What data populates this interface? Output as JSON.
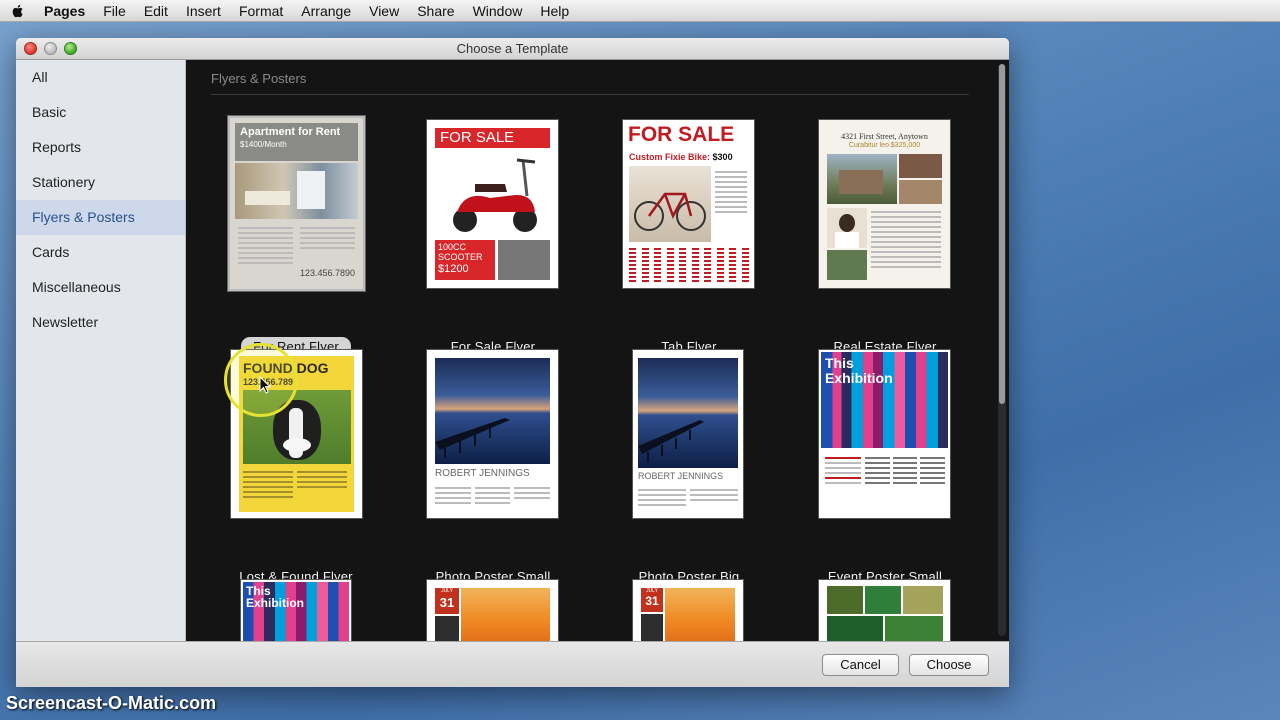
{
  "menubar": {
    "app_name": "Pages",
    "items": [
      "File",
      "Edit",
      "Insert",
      "Format",
      "Arrange",
      "View",
      "Share",
      "Window",
      "Help"
    ]
  },
  "window": {
    "title": "Choose a Template"
  },
  "sidebar": {
    "items": [
      {
        "label": "All"
      },
      {
        "label": "Basic"
      },
      {
        "label": "Reports"
      },
      {
        "label": "Stationery"
      },
      {
        "label": "Flyers & Posters"
      },
      {
        "label": "Cards"
      },
      {
        "label": "Miscellaneous"
      },
      {
        "label": "Newsletter"
      }
    ],
    "selected": "Flyers & Posters"
  },
  "content": {
    "section_title": "Flyers & Posters",
    "templates": [
      {
        "label": "For Rent Flyer",
        "thumb": {
          "title": "Apartment for Rent",
          "subtitle": "$1400/Month",
          "phone": "123.456.7890"
        }
      },
      {
        "label": "For Sale Flyer",
        "thumb": {
          "title": "FOR SALE",
          "promo_line1": "100CC",
          "promo_line2": "SCOOTER",
          "price": "$1200"
        }
      },
      {
        "label": "Tab Flyer",
        "thumb": {
          "title": "FOR SALE",
          "subtitle": "Custom Fixie Bike:",
          "price": "$300"
        }
      },
      {
        "label": "Real Estate Flyer",
        "thumb": {
          "title": "4321 First Street, Anytown",
          "subtitle": "Curabitur leo $325,000"
        }
      },
      {
        "label": "Lost & Found Flyer",
        "thumb": {
          "title": "FOUND DOG",
          "phone": "123.456.789"
        }
      },
      {
        "label": "Photo Poster Small",
        "thumb": {
          "name": "ROBERT JENNINGS"
        }
      },
      {
        "label": "Photo Poster Big",
        "thumb": {
          "name": "ROBERT JENNINGS"
        }
      },
      {
        "label": "Event Poster Small",
        "thumb": {
          "title_line1": "This",
          "title_line2": "Exhibition"
        }
      },
      {
        "label": "",
        "thumb": {
          "title_line1": "This",
          "title_line2": "Exhibition"
        }
      },
      {
        "label": "",
        "thumb": {
          "month": "JULY",
          "day": "31"
        }
      },
      {
        "label": "",
        "thumb": {
          "month": "JULY",
          "day": "31"
        }
      },
      {
        "label": "",
        "thumb": {}
      }
    ],
    "selected_template": "For Rent Flyer"
  },
  "buttons": {
    "cancel": "Cancel",
    "choose": "Choose"
  },
  "watermark": "Screencast-O-Matic.com",
  "colors": {
    "selection_blue": "#cdd9ea",
    "content_bg": "#141414",
    "for_sale_red": "#d8262b",
    "found_dog_yellow": "#f2d63a"
  }
}
